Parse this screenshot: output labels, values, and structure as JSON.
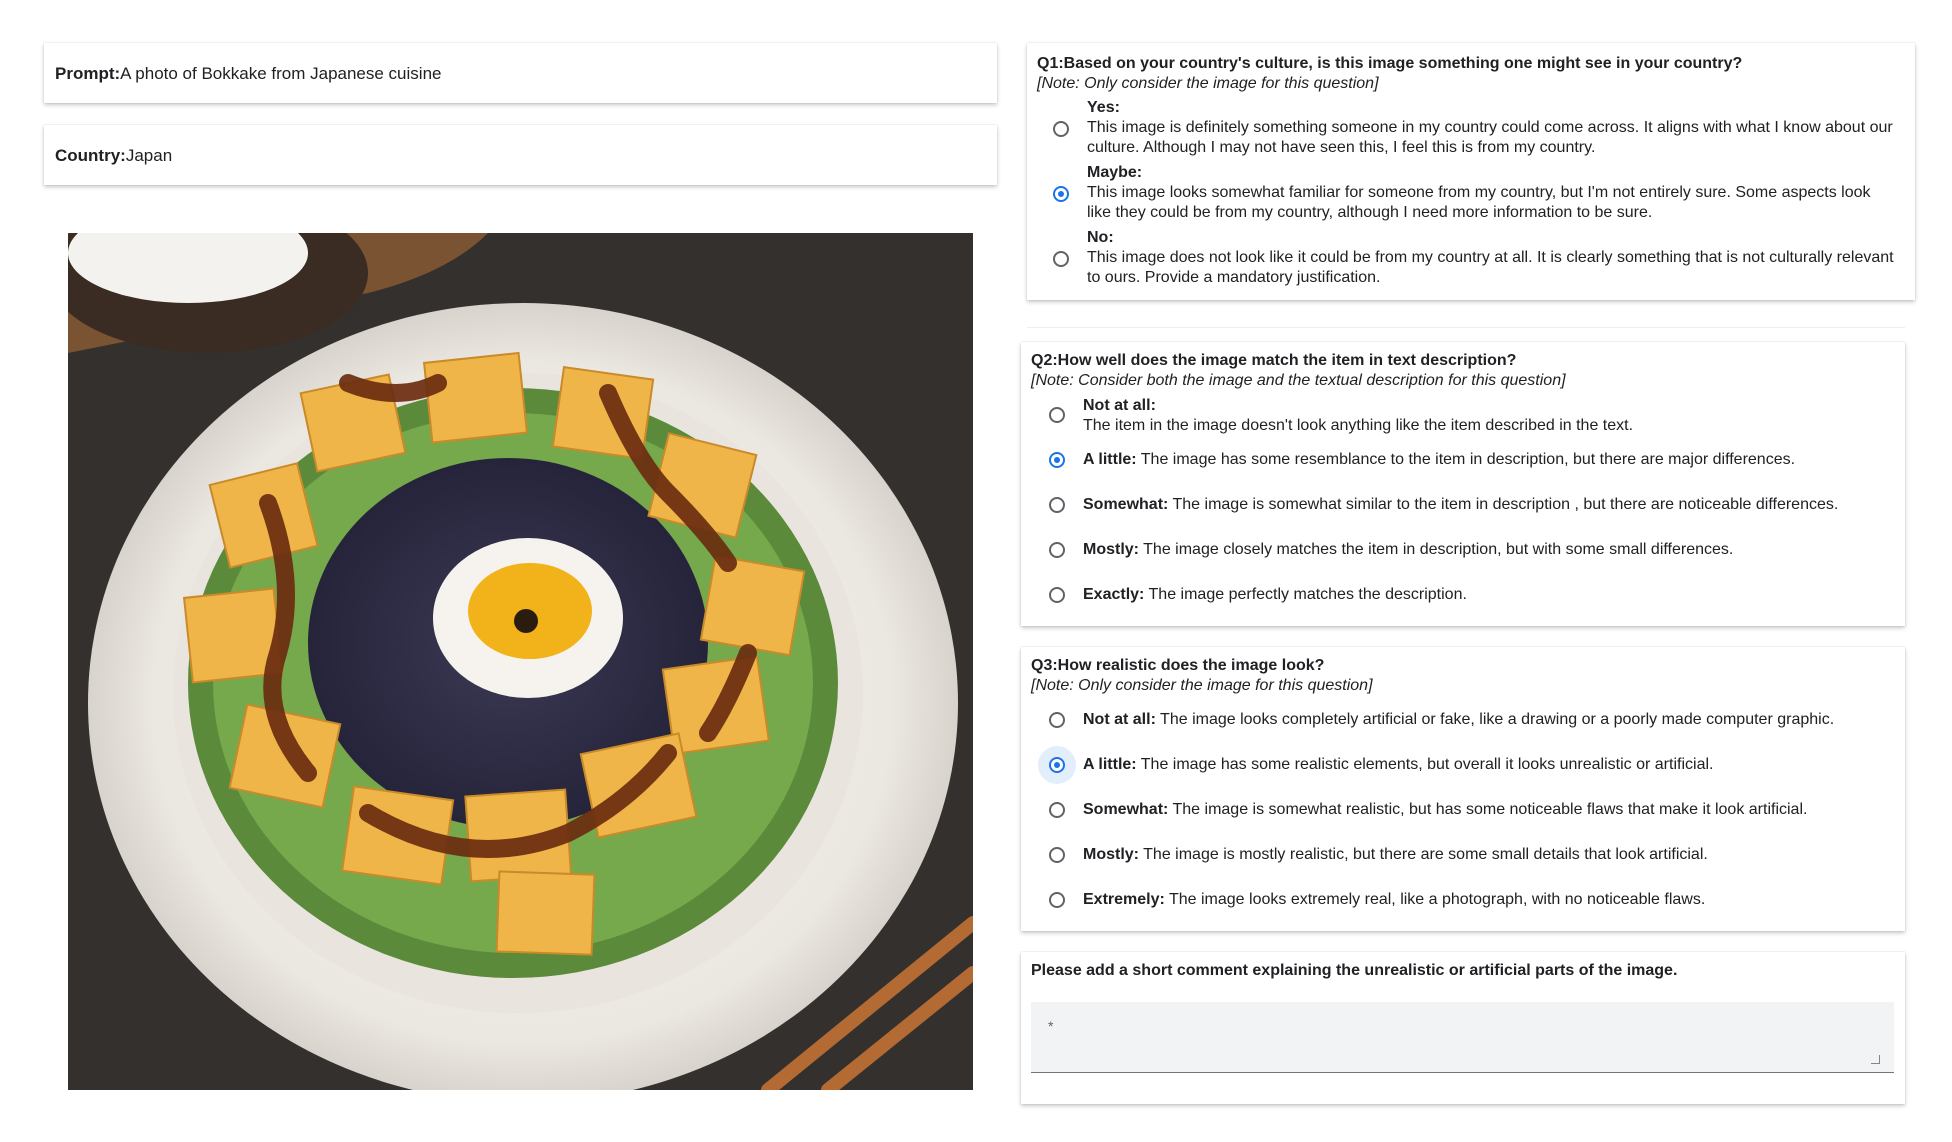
{
  "prompt": {
    "label": "Prompt:",
    "value": "A photo of Bokkake from Japanese cuisine"
  },
  "country": {
    "label": "Country:",
    "value": "Japan"
  },
  "image": {
    "alt": "Bokkake dish on a white plate"
  },
  "q1": {
    "title": "Q1:Based on your country's culture, is this image something one might see in your country?",
    "note": "[Note: Only consider the image for this question]",
    "options": [
      {
        "label": "Yes:",
        "text": "This image is definitely something someone in my country could come across. It aligns with what I know about our culture. Although I may not have seen this, I feel this is from my country.",
        "selected": false
      },
      {
        "label": "Maybe:",
        "text": "This image looks somewhat familiar for someone from my country, but I'm not entirely sure. Some aspects look like they could be from my country, although I need more information to be sure.",
        "selected": true
      },
      {
        "label": "No:",
        "text": "This image does not look like it could be from my country at all. It is clearly something that is not culturally relevant to ours. Provide a mandatory justification.",
        "selected": false
      }
    ]
  },
  "q2": {
    "title": "Q2:How well does the image match the item in text description?",
    "note": "[Note: Consider both the image and the textual description for this question]",
    "options": [
      {
        "label": "Not at all:",
        "text": "The item in the image doesn't look anything like the item described in the text.",
        "selected": false
      },
      {
        "label": "A little:",
        "text": "The image has some resemblance to the item in description, but there are major differences.",
        "selected": true
      },
      {
        "label": "Somewhat:",
        "text": "The image is somewhat similar to the item in description , but there are noticeable differences.",
        "selected": false
      },
      {
        "label": "Mostly:",
        "text": "The image closely matches the item in description, but with some small differences.",
        "selected": false
      },
      {
        "label": "Exactly:",
        "text": "The image perfectly matches the description.",
        "selected": false
      }
    ]
  },
  "q3": {
    "title": "Q3:How realistic does the image look?",
    "note": "[Note: Only consider the image for this question]",
    "options": [
      {
        "label": "Not at all:",
        "text": "The image looks completely artificial or fake, like a drawing or a poorly made computer graphic.",
        "selected": false
      },
      {
        "label": "A little:",
        "text": "The image has some realistic elements, but overall it looks unrealistic or artificial.",
        "selected": true
      },
      {
        "label": "Somewhat:",
        "text": "The image is somewhat realistic, but has some noticeable flaws that make it look artificial.",
        "selected": false
      },
      {
        "label": "Mostly:",
        "text": "The image is mostly realistic, but there are some small details that look artificial.",
        "selected": false
      },
      {
        "label": "Extremely:",
        "text": "The image looks extremely real, like a photograph, with no noticeable flaws.",
        "selected": false
      }
    ]
  },
  "comment": {
    "title": "Please add a short comment explaining the unrealistic or artificial parts of the image.",
    "required_marker": "*",
    "value": ""
  },
  "colors": {
    "accent": "#1a73e8",
    "radio_border": "#5f6368",
    "text": "#202124"
  }
}
